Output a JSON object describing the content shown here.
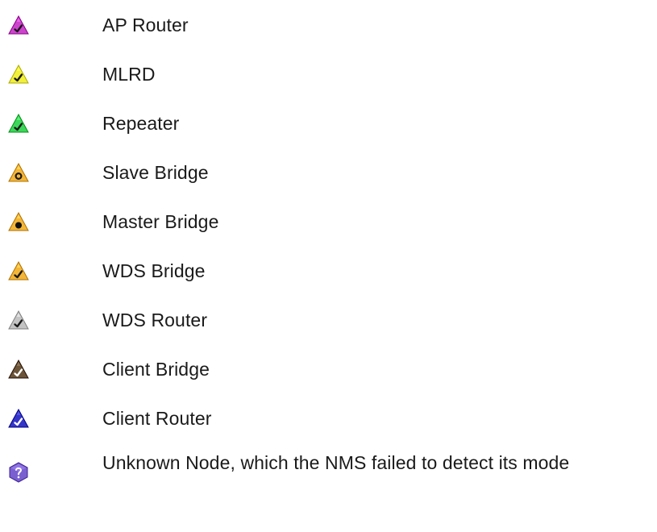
{
  "legend": {
    "items": [
      {
        "label": "AP Router",
        "icon": "ap-router-icon",
        "color": "#cc44cc",
        "mark": "check"
      },
      {
        "label": "MLRD",
        "icon": "mlrd-icon",
        "color": "#f2f03a",
        "mark": "check"
      },
      {
        "label": "Repeater",
        "icon": "repeater-icon",
        "color": "#3dd65a",
        "mark": "check"
      },
      {
        "label": "Slave Bridge",
        "icon": "slave-bridge-icon",
        "color": "#f4b638",
        "mark": "ring"
      },
      {
        "label": "Master Bridge",
        "icon": "master-bridge-icon",
        "color": "#f4b638",
        "mark": "dot"
      },
      {
        "label": "WDS Bridge",
        "icon": "wds-bridge-icon",
        "color": "#f4b638",
        "mark": "check"
      },
      {
        "label": "WDS Router",
        "icon": "wds-router-icon",
        "color": "#c4c4c4",
        "mark": "check"
      },
      {
        "label": "Client Bridge",
        "icon": "client-bridge-icon",
        "color": "#6b5438",
        "mark": "check-light"
      },
      {
        "label": "Client Router",
        "icon": "client-router-icon",
        "color": "#3535c8",
        "mark": "check-light"
      },
      {
        "label": "Unknown Node, which the NMS failed to detect its mode",
        "icon": "unknown-node-icon",
        "color": "#7a5fd0",
        "mark": "question"
      }
    ]
  }
}
